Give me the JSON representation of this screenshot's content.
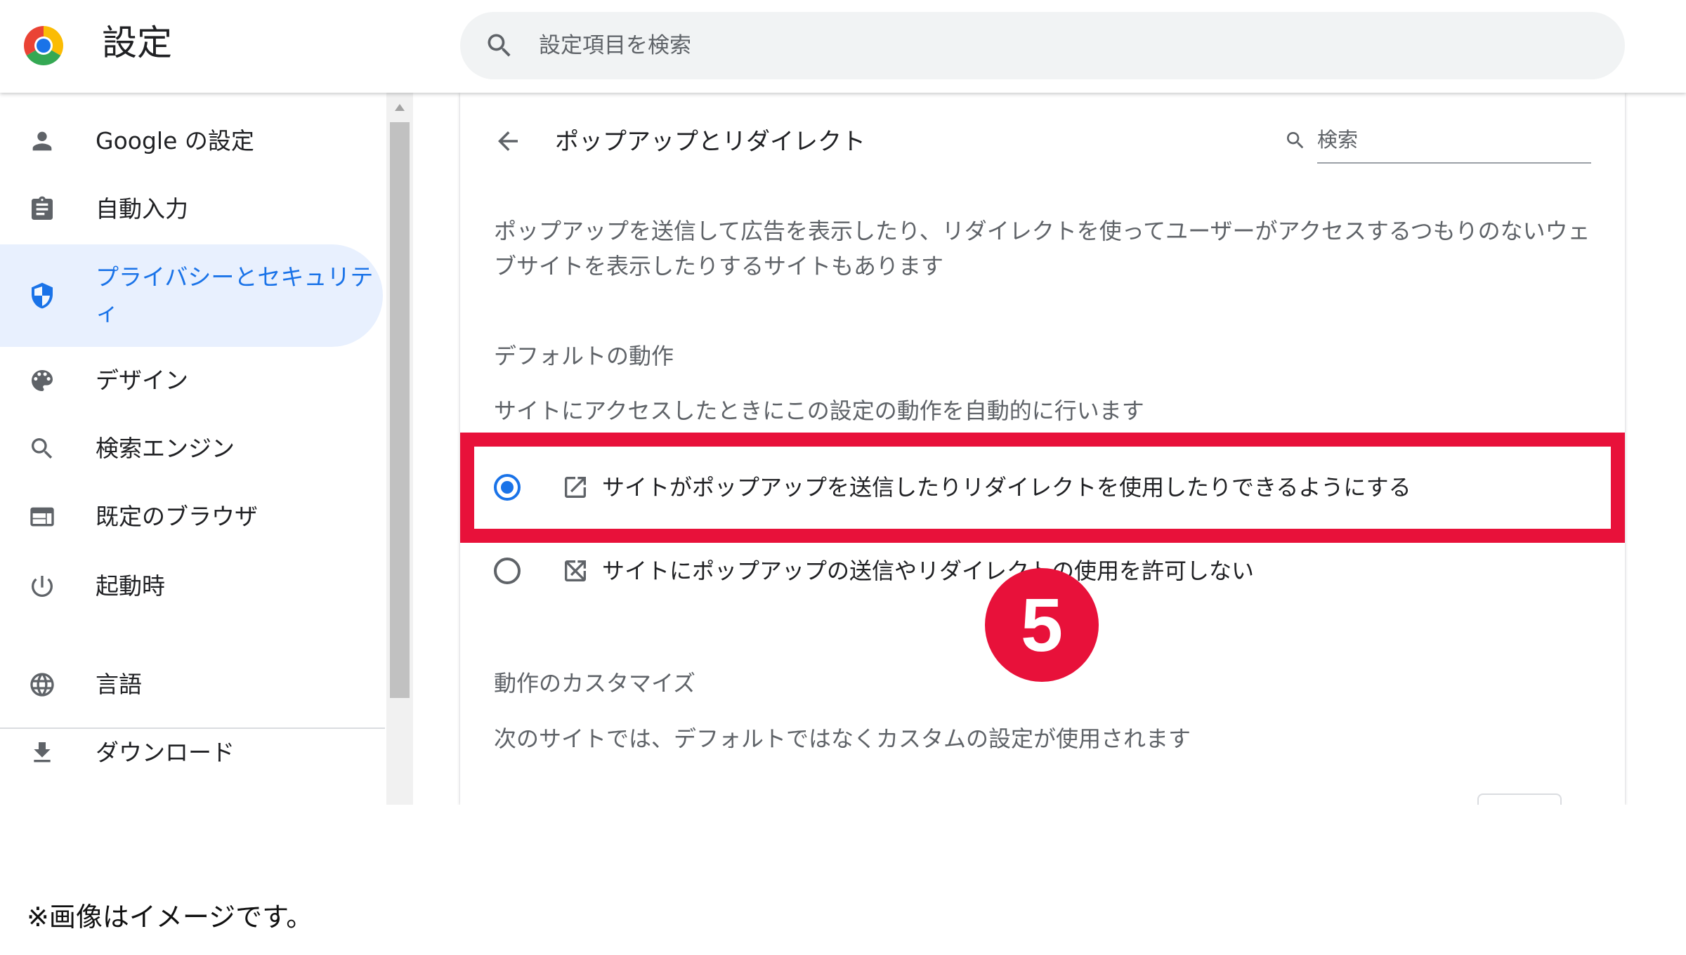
{
  "header": {
    "title": "設定",
    "search_placeholder": "設定項目を検索"
  },
  "sidebar": {
    "items": [
      {
        "label": "Google の設定",
        "icon": "person-icon"
      },
      {
        "label": "自動入力",
        "icon": "clipboard-icon"
      },
      {
        "label": "プライバシーとセキュリティ",
        "icon": "shield-icon",
        "active": true
      },
      {
        "label": "デザイン",
        "icon": "palette-icon"
      },
      {
        "label": "検索エンジン",
        "icon": "search-icon"
      },
      {
        "label": "既定のブラウザ",
        "icon": "browser-window-icon"
      },
      {
        "label": "起動時",
        "icon": "power-icon"
      },
      {
        "label": "言語",
        "icon": "globe-icon"
      },
      {
        "label": "ダウンロード",
        "icon": "download-icon"
      }
    ]
  },
  "content": {
    "heading": "ポップアップとリダイレクト",
    "filter_placeholder": "検索",
    "description": "ポップアップを送信して広告を表示したり、リダイレクトを使ってユーザーがアクセスするつもりのないウェブサイトを表示したりするサイトもあります",
    "default_behavior": {
      "heading": "デフォルトの動作",
      "subtitle": "サイトにアクセスしたときにこの設定の動作を自動的に行います",
      "options": [
        {
          "label": "サイトがポップアップを送信したりリダイレクトを使用したりできるようにする",
          "icon": "open-in-new-icon",
          "selected": true
        },
        {
          "label": "サイトにポップアップの送信やリダイレクトの使用を許可しない",
          "icon": "blocked-open-in-new-icon",
          "selected": false
        }
      ]
    },
    "customize": {
      "heading": "動作のカスタマイズ",
      "subtitle": "次のサイトでは、デフォルトではなくカスタムの設定が使用されます"
    }
  },
  "overlay": {
    "step_number": "5",
    "accent_color": "#e8113a"
  },
  "footnote": "※画像はイメージです。",
  "colors": {
    "active_blue": "#1a73e8",
    "active_bg": "#e8f0fe"
  }
}
